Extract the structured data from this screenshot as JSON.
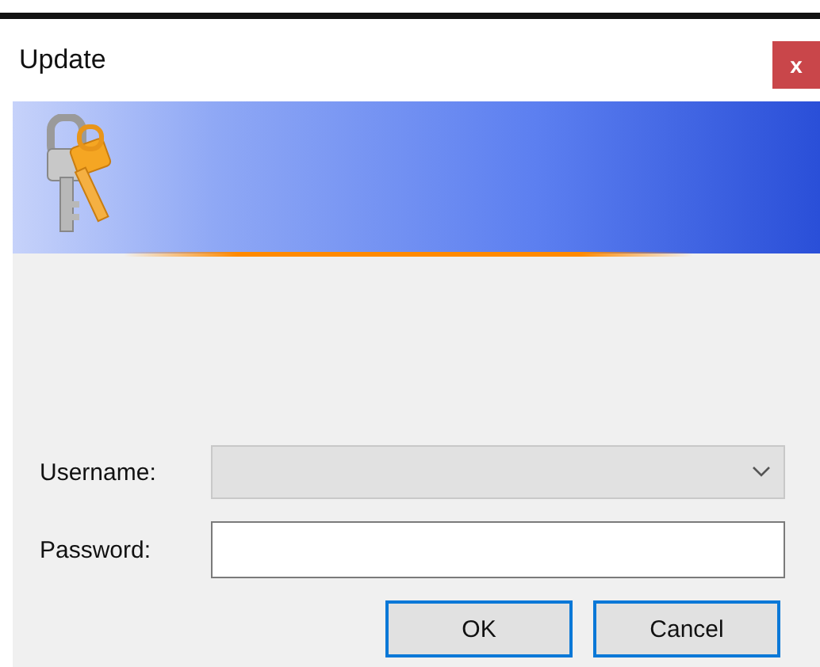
{
  "window": {
    "title": "Update",
    "close": "x"
  },
  "form": {
    "username": {
      "label": "Username:",
      "disabled": true
    },
    "password": {
      "label": "Password:"
    }
  },
  "buttons": [
    {
      "label": "OK",
      "focused": true
    },
    {
      "label": "Cancel",
      "focused": true
    }
  ]
}
